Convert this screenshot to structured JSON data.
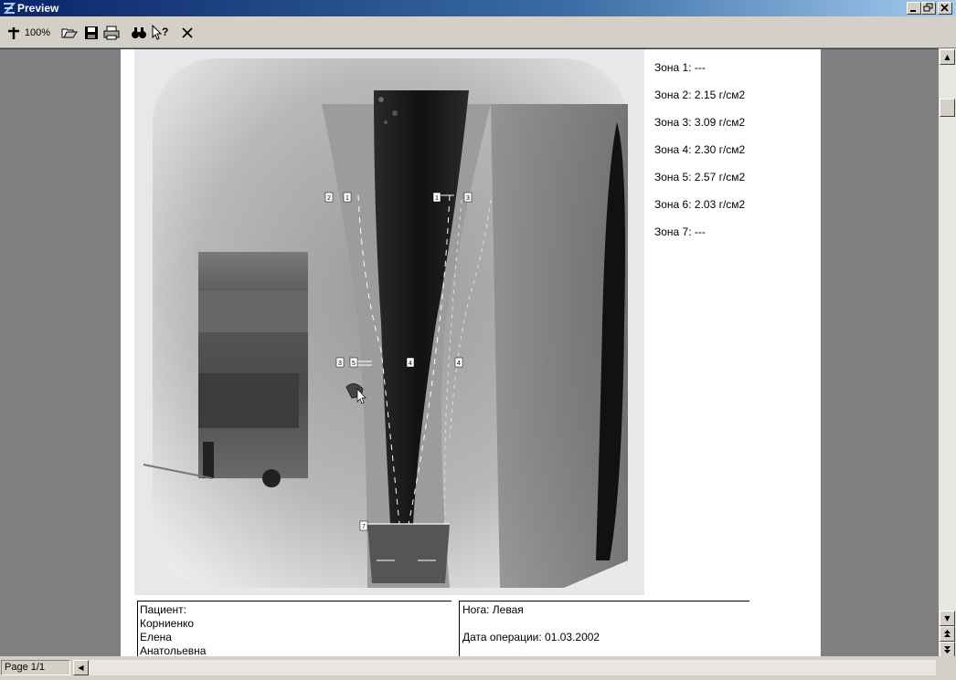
{
  "window": {
    "title": "Preview"
  },
  "toolbar": {
    "zoom_label": "100%",
    "buttons": [
      "zoom-icon",
      "open-icon",
      "save-icon",
      "print-icon",
      "find-icon",
      "help-pointer-icon",
      "close-icon"
    ]
  },
  "zones": [
    "Зона 1: ---",
    "Зона 2: 2.15 г/см2",
    "Зона 3: 3.09 г/см2",
    "Зона 4: 2.30 г/см2",
    "Зона 5: 2.57 г/см2",
    "Зона 6: 2.03 г/см2",
    "Зона 7: ---"
  ],
  "footer": {
    "patient_label": "Пациент:",
    "patient_surname": "Корниенко",
    "patient_name": "Елена",
    "patient_patronymic": "Анатольевна",
    "leg": "Нога: Левая",
    "operation_date": "Дата операции: 01.03.2002"
  },
  "xray_markers": [
    "2",
    "1",
    "1",
    "3",
    "3",
    "5",
    "4",
    "4",
    "7"
  ],
  "status": {
    "page": "Page 1/1"
  },
  "colors": {
    "titlebar_start": "#0a246a",
    "titlebar_end": "#a6caf0",
    "workspace": "#808080",
    "chrome": "#d4d0c8"
  }
}
